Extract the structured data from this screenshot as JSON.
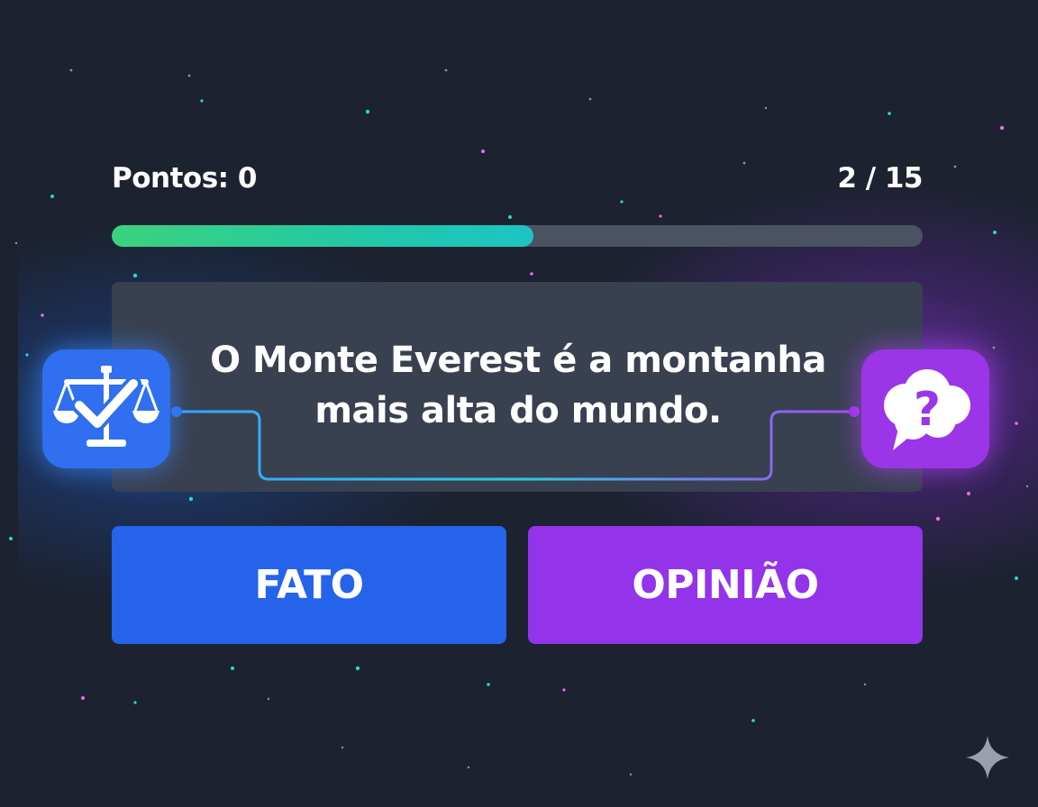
{
  "hud": {
    "score_label": "Pontos: 0",
    "counter_label": "2 / 15",
    "progress": {
      "current": 2,
      "total": 15,
      "fill_fraction": 0.52
    }
  },
  "question": {
    "text": "O Monte Everest é a montanha mais alta do mundo."
  },
  "badges": {
    "fact_icon": "scales-check-icon",
    "opinion_icon": "thought-cloud-question-icon"
  },
  "answers": {
    "fact_label": "FATO",
    "opinion_label": "OPINIÃO"
  },
  "colors": {
    "background": "#1c2230",
    "card": "#394050",
    "fact": "#2563eb",
    "opinion": "#9333ea",
    "progress_start": "#3bd27c",
    "progress_end": "#1ec4c4",
    "progress_track": "#4b5362"
  }
}
